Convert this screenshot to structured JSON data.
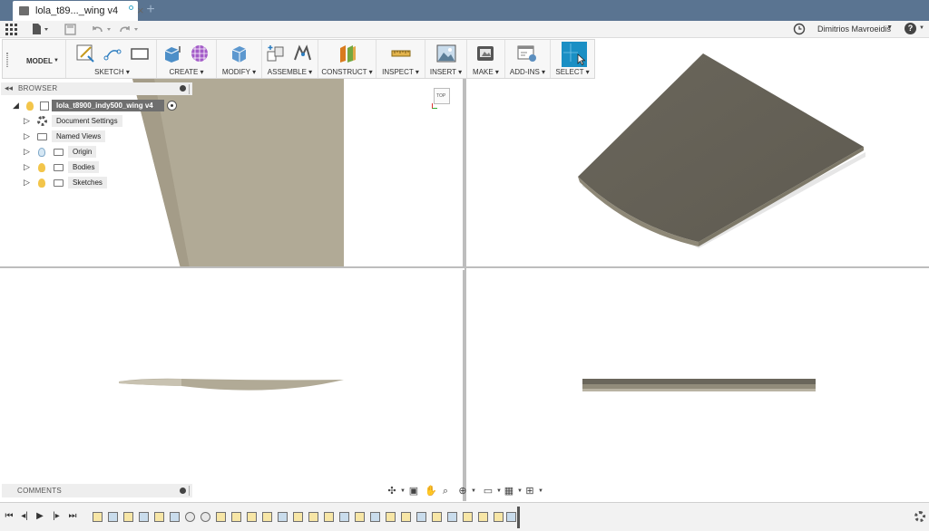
{
  "tab": {
    "title": "lola_t89..._wing v4",
    "close": "×",
    "add": "+"
  },
  "quick_access": {
    "user": "Dimitrios Mavroeidis",
    "help": "?"
  },
  "toolbar": {
    "workspace": "MODEL",
    "groups": [
      {
        "label": "SKETCH"
      },
      {
        "label": "CREATE"
      },
      {
        "label": "MODIFY"
      },
      {
        "label": "ASSEMBLE"
      },
      {
        "label": "CONSTRUCT"
      },
      {
        "label": "INSPECT"
      },
      {
        "label": "INSERT"
      },
      {
        "label": "MAKE"
      },
      {
        "label": "ADD-INS"
      },
      {
        "label": "SELECT"
      }
    ]
  },
  "browser": {
    "title": "BROWSER",
    "root": "lola_t8900_indy500_wing v4",
    "items": [
      {
        "label": "Document Settings"
      },
      {
        "label": "Named Views"
      },
      {
        "label": "Origin"
      },
      {
        "label": "Bodies"
      },
      {
        "label": "Sketches"
      }
    ]
  },
  "viewcube": {
    "face": "TOP"
  },
  "comments": {
    "title": "COMMENTS"
  },
  "colors": {
    "title_bar": "#5a7491",
    "body": "#6b675c",
    "body_light": "#b2ab98",
    "select_accent": "#1a8fc4"
  }
}
